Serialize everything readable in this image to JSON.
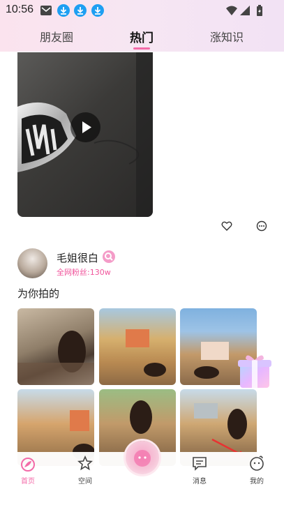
{
  "status_bar": {
    "time": "10:56"
  },
  "tabs": [
    {
      "label": "朋友圈",
      "active": false
    },
    {
      "label": "热门",
      "active": true
    },
    {
      "label": "涨知识",
      "active": false
    }
  ],
  "post": {
    "username": "毛姐很白",
    "followers": "全网粉丝:130w",
    "text": "为你拍的"
  },
  "bottom_nav": [
    {
      "label": "首页",
      "icon": "home-icon",
      "active": true
    },
    {
      "label": "空间",
      "icon": "star-icon",
      "active": false
    },
    {
      "label": "消息",
      "icon": "message-icon",
      "active": false
    },
    {
      "label": "我的",
      "icon": "profile-face-icon",
      "active": false
    }
  ],
  "colors": {
    "accent": "#f36aa8",
    "download_badge": "#1e9ff2"
  }
}
